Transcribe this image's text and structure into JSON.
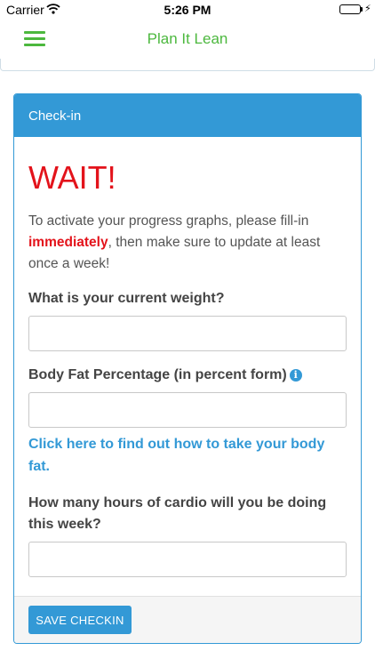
{
  "status_bar": {
    "carrier": "Carrier",
    "time": "5:26 PM",
    "icons": [
      "wifi-icon",
      "battery-icon",
      "charging-bolt-icon"
    ]
  },
  "nav": {
    "title": "Plan It Lean",
    "menu_icon": "hamburger-menu-icon",
    "accent_color": "#4cb83e"
  },
  "card": {
    "header": "Check-in",
    "header_color": "#3399d6",
    "wait": "WAIT!",
    "intro_before": "To activate your progress graphs, please fill-in ",
    "intro_highlight": "immediately",
    "intro_after": ", then make sure to update at least once a week!",
    "highlight_color": "#e3131b",
    "weight_label": "What is your current weight?",
    "weight_value": "",
    "bodyfat_label": "Body Fat Percentage (in percent form)",
    "bodyfat_value": "",
    "info_icon": "info-icon",
    "bodyfat_link": "Click here to find out how to take your body fat.",
    "cardio_label": "How many hours of cardio will you be doing this week?",
    "cardio_value": "",
    "save_label": "SAVE CHECKIN"
  }
}
